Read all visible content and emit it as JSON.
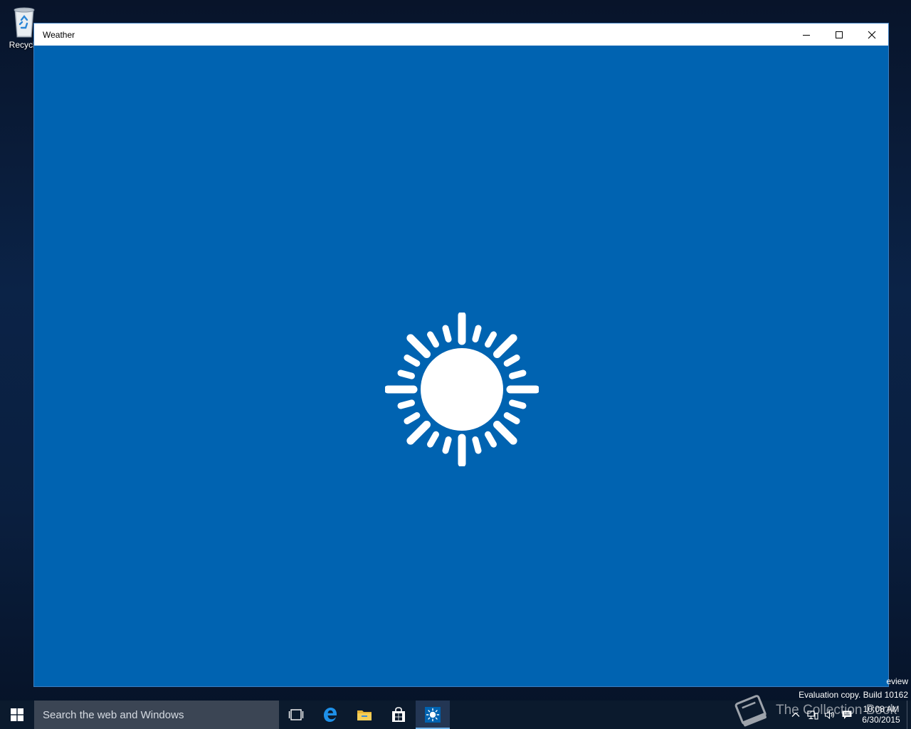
{
  "desktop": {
    "icons": [
      {
        "label": "Recycle",
        "icon": "recycle-bin-icon"
      }
    ]
  },
  "window": {
    "title": "Weather",
    "controls": {
      "minimize": "minimize-icon",
      "maximize": "maximize-icon",
      "close": "close-icon"
    },
    "background_color": "#0063b1",
    "splash_icon": "sun-icon"
  },
  "watermark": {
    "line1": "eview",
    "line2": "Evaluation copy. Build 10162"
  },
  "taskbar": {
    "search_placeholder": "Search the web and Windows",
    "pinned": [
      {
        "name": "task-view",
        "icon": "task-view-icon"
      },
      {
        "name": "edge",
        "icon": "edge-icon"
      },
      {
        "name": "file-explorer",
        "icon": "folder-icon"
      },
      {
        "name": "store",
        "icon": "store-icon"
      },
      {
        "name": "weather",
        "icon": "sun-icon",
        "active": true
      }
    ],
    "tray": {
      "icons": [
        "chevron-up-icon",
        "network-icon",
        "volume-icon",
        "action-center-icon"
      ],
      "time": "10:08 AM",
      "date": "6/30/2015"
    }
  },
  "overlay": {
    "text": "The Collection Book"
  }
}
